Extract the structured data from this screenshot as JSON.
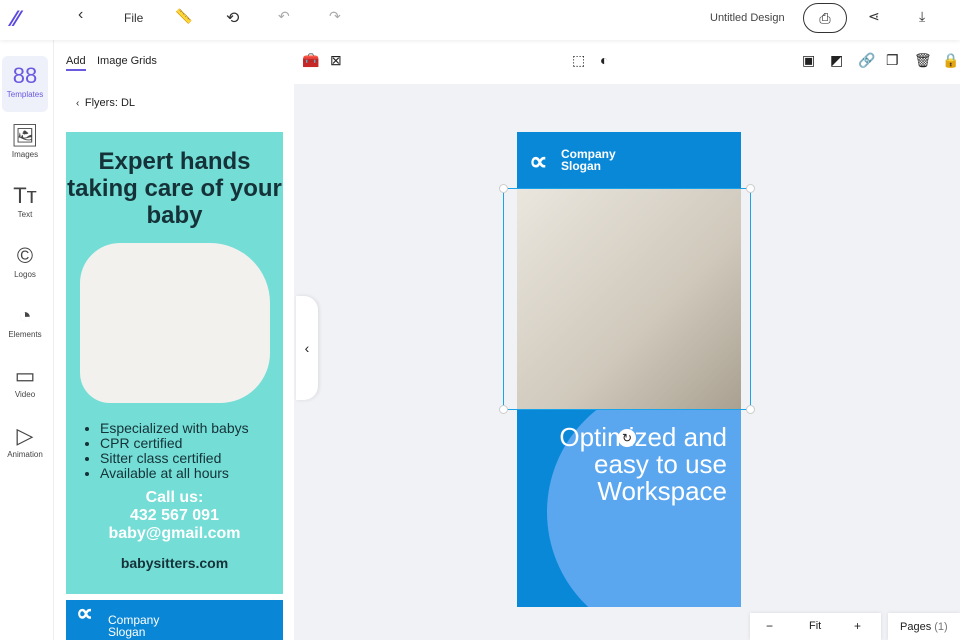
{
  "header": {
    "file": "File",
    "title": "Untitled Design"
  },
  "rail": [
    {
      "label": "Templates",
      "icon": "88"
    },
    {
      "label": "Images",
      "icon": "🖼"
    },
    {
      "label": "Text",
      "icon": "Tт"
    },
    {
      "label": "Logos",
      "icon": "©"
    },
    {
      "label": "Elements",
      "icon": "◔"
    },
    {
      "label": "Video",
      "icon": "▭"
    },
    {
      "label": "Animation",
      "icon": "▷"
    }
  ],
  "panel": {
    "tabs": [
      "Add",
      "Image Grids"
    ],
    "breadcrumb": "Flyers: DL"
  },
  "template1": {
    "headline": "Expert hands taking care of your baby",
    "bullets": [
      "Especialized with babys",
      "CPR certified",
      "Sitter class certified",
      "Available at all hours"
    ],
    "call": "Call us:",
    "phone": "432 567 091",
    "email": "baby@gmail.com",
    "site": "babysitters.com"
  },
  "template2": {
    "company": "Company",
    "slogan": "Slogan"
  },
  "design": {
    "company": "Company",
    "slogan": "Slogan",
    "text": "Optimized and easy to use Workspace"
  },
  "zoom": {
    "minus": "−",
    "level": "Fit",
    "plus": "+"
  },
  "pages": {
    "label": "Pages",
    "count": "(1)"
  }
}
